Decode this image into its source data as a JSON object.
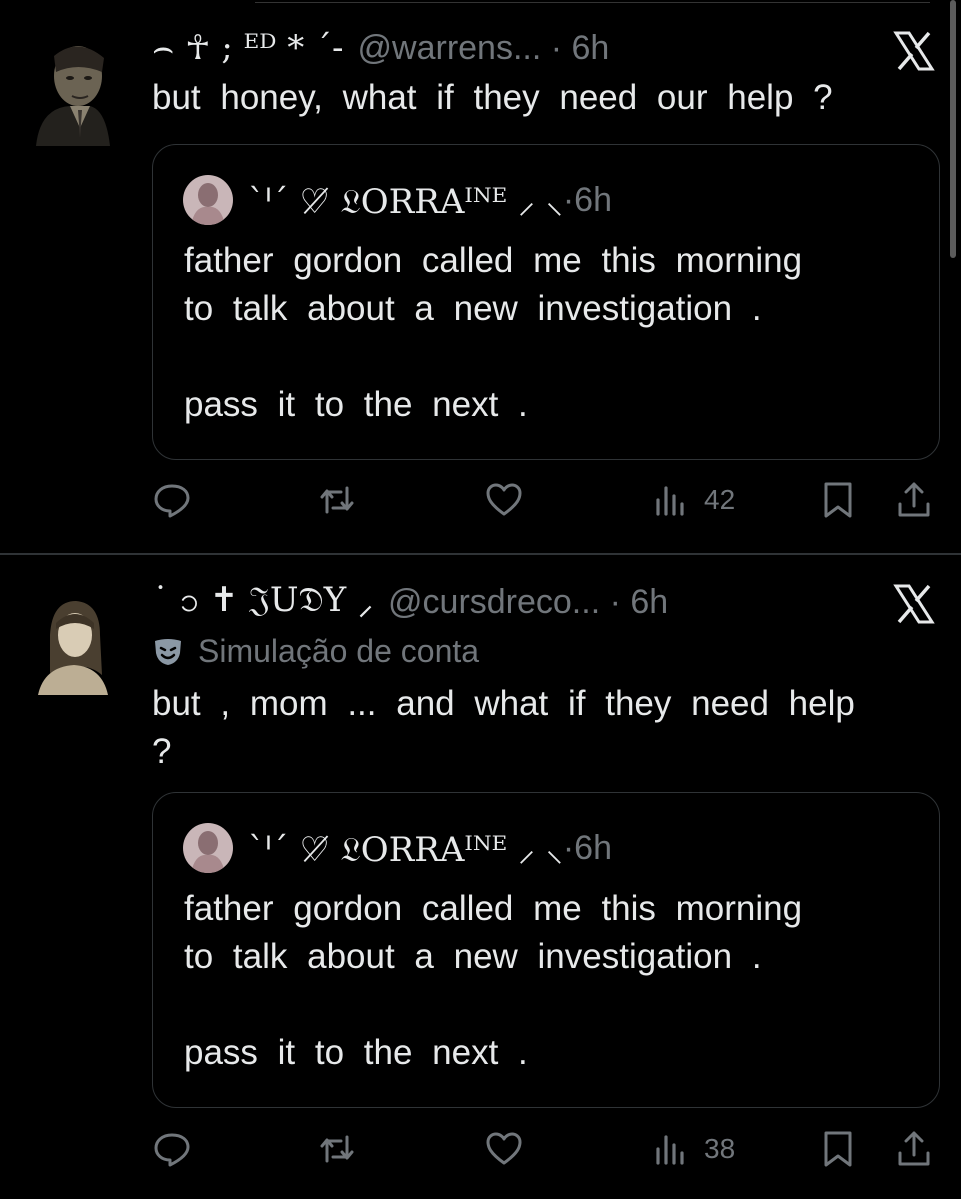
{
  "colors": {
    "background": "#000000",
    "text": "#e7e9ea",
    "muted": "#71767b",
    "border": "#2f3336"
  },
  "posts": [
    {
      "author_display": "⌢  ☥  ;  ᴱᴰ  *  ˊ-",
      "handle": "@warrens...",
      "time": "6h",
      "text": "but honey, what if they need our help ?",
      "quote": {
        "author_display": "ˋᑊˊ  ♡̸  𝔏ORRAᴵᴺᴱ  ⸝  ⸜",
        "time": "6h",
        "lines": [
          "father gordon called me this morning",
          "to talk about a new investigation .",
          "pass it to the next ."
        ]
      },
      "views": "42"
    },
    {
      "author_display": "˙  ၁  ✝  𝔍U𝔇Y  ⸝",
      "handle": "@cursdreco...",
      "time": "6h",
      "badge": "Simulação de conta",
      "text_line1": "but , mom ... and what if they need help",
      "text_line2": "?",
      "quote": {
        "author_display": "ˋᑊˊ  ♡̸  𝔏ORRAᴵᴺᴱ  ⸝  ⸜",
        "time": "6h",
        "lines": [
          "father gordon called me this morning",
          "to talk about a new investigation .",
          "pass it to the next ."
        ]
      },
      "views": "38"
    }
  ],
  "icons": [
    "x-logo-icon",
    "reply-icon",
    "retweet-icon",
    "like-icon",
    "views-icon",
    "bookmark-icon",
    "share-icon",
    "mask-icon"
  ]
}
